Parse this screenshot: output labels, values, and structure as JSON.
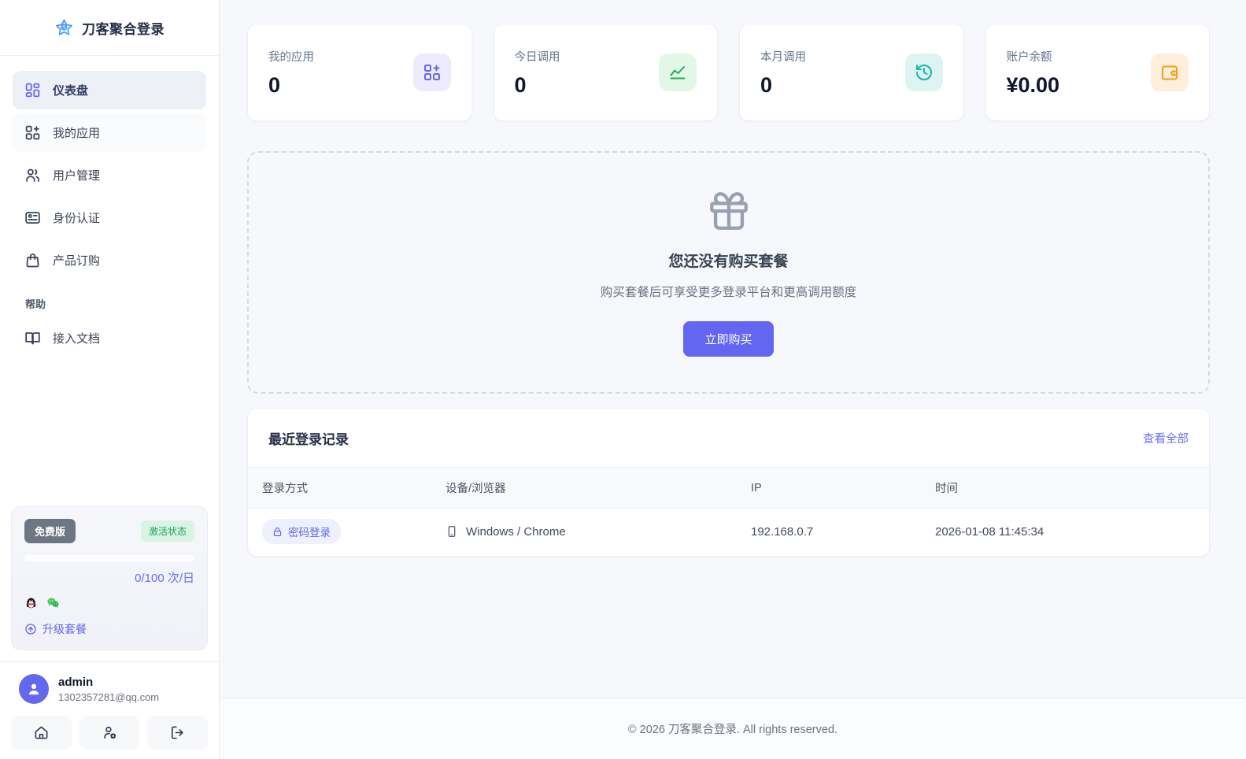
{
  "app": {
    "title": "刀客聚合登录"
  },
  "sidebar": {
    "logo": {
      "text": "刀客聚合登录"
    },
    "nav": [
      {
        "label": "仪表盘",
        "active": true
      },
      {
        "label": "我的应用"
      },
      {
        "label": "用户管理"
      },
      {
        "label": "身份认证"
      },
      {
        "label": "产品订购"
      }
    ],
    "help": {
      "section_label": "帮助",
      "items": [
        {
          "label": "接入文档"
        }
      ]
    },
    "plan": {
      "name": "免费版",
      "status": "激活状态",
      "quota": "0/100 次/日",
      "progress_percent": 0,
      "platforms": [
        "qq",
        "wechat"
      ],
      "upgrade": "升级套餐"
    },
    "user": {
      "name": "admin",
      "email": "1302357281@qq.com"
    }
  },
  "stats": [
    {
      "label": "我的应用",
      "value": "0",
      "accent": "#6366f1",
      "bg": "#ecebfc"
    },
    {
      "label": "今日调用",
      "value": "0",
      "accent": "#21ab58",
      "bg": "#e3f7e9"
    },
    {
      "label": "本月调用",
      "value": "0",
      "accent": "#14b8a6",
      "bg": "#def4f3"
    },
    {
      "label": "账户余额",
      "value": "¥0.00",
      "accent": "#f59e0b",
      "bg": "#fdeedd"
    }
  ],
  "empty_state": {
    "title": "您还没有购买套餐",
    "subtitle": "购买套餐后可享受更多登录平台和更高调用额度",
    "cta": "立即购买"
  },
  "recent_logins": {
    "title": "最近登录记录",
    "view_all": "查看全部",
    "columns": [
      "登录方式",
      "设备/浏览器",
      "IP",
      "时间"
    ],
    "rows": [
      {
        "method": "密码登录",
        "device": "Windows / Chrome",
        "ip": "192.168.0.7",
        "time": "2026-01-08 11:45:34"
      }
    ]
  },
  "footer": {
    "text": "© 2026 刀客聚合登录. All rights reserved."
  }
}
